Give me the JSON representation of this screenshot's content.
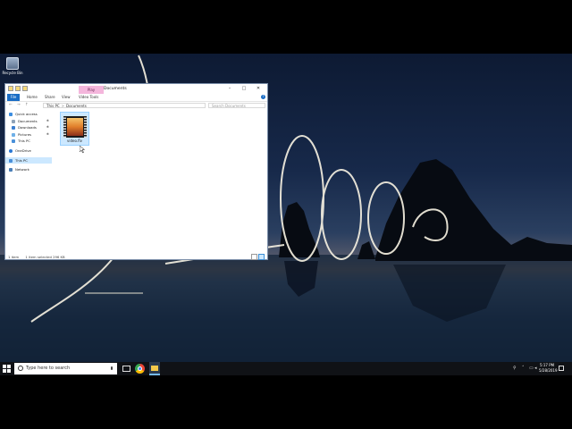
{
  "desktop": {
    "icons": [
      {
        "label": "Recycle Bin"
      }
    ]
  },
  "window": {
    "title": "Documents",
    "context_tab": "Play",
    "controls": {
      "minimize": "–",
      "maximize": "□",
      "close": "✕"
    },
    "ribbon_tabs": [
      "File",
      "Home",
      "Share",
      "View",
      "Video Tools"
    ],
    "help_label": "?",
    "nav": {
      "back": "←",
      "forward": "→",
      "up": "↑"
    },
    "address": {
      "segments": [
        "This PC",
        "Documents"
      ],
      "separator": ">"
    },
    "search": {
      "placeholder": "Search Documents"
    },
    "sidebar": [
      {
        "label": "Quick access",
        "pinned": false
      },
      {
        "label": "Documents",
        "pinned": true
      },
      {
        "label": "Downloads",
        "pinned": true
      },
      {
        "label": "Pictures",
        "pinned": true
      },
      {
        "label": "This PC",
        "pinned": false
      },
      {
        "label": "OneDrive",
        "pinned": false
      },
      {
        "label": "This PC",
        "pinned": false,
        "selected": true
      },
      {
        "label": "Network",
        "pinned": false
      }
    ],
    "pin_glyph": "✱",
    "files": [
      {
        "name": "video.flv",
        "selected": true
      }
    ],
    "status": {
      "items": "1 item",
      "selected": "1 item selected  296 KB"
    }
  },
  "taskbar": {
    "search_placeholder": "Type here to search",
    "time": "5:17 PM",
    "date": "5/28/2019"
  },
  "colors": {
    "accent": "#1a6dc5",
    "selection": "#cce8ff",
    "context_tab": "#f4b6dc",
    "taskbar": "#101216"
  }
}
